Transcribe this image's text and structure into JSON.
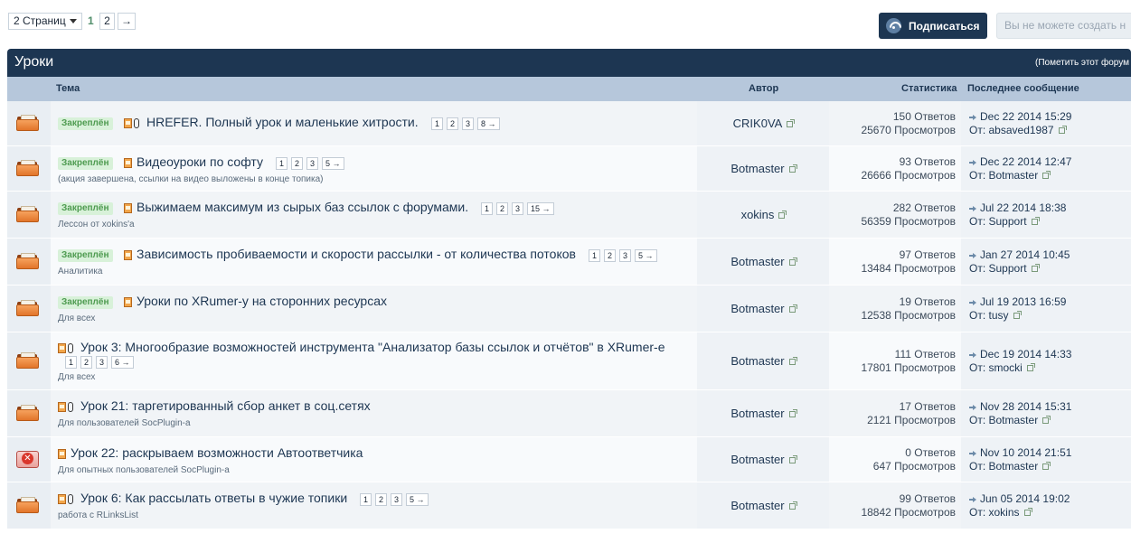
{
  "pagination": {
    "pages_label": "2 Страниц",
    "current": "1",
    "page2": "2",
    "next": "→"
  },
  "actions": {
    "subscribe": "Подписаться",
    "cannot_create": "Вы не можете создать н"
  },
  "forum": {
    "title": "Уроки",
    "mark_read": "(Пометить этот форум"
  },
  "columns": {
    "topic": "Тема",
    "author": "Автор",
    "stats": "Статистика",
    "last_post": "Последнее сообщение"
  },
  "pinned_label": "Закреплён",
  "colors": {
    "header_bg": "#1d3652",
    "column_header_bg": "#b6c7db",
    "pinned_bg": "#d8f1d9",
    "pinned_text": "#4e9b50"
  },
  "topics": [
    {
      "icon": "folder-icon",
      "pinned": true,
      "attachment": true,
      "title": "HREFER. Полный урок и маленькие хитрости.",
      "description": "",
      "pages": [
        "1",
        "2",
        "3",
        "8 →"
      ],
      "author": "CRIK0VA",
      "replies": "150 Ответов",
      "views": "25670 Просмотров",
      "last_date": "Dec 22 2014 15:29",
      "last_by": "От: absaved1987"
    },
    {
      "icon": "folder-icon",
      "pinned": true,
      "attachment": false,
      "title": "Видеоуроки по софту",
      "description": "(акция завершена, ссылки на видео выложены в конце топика)",
      "pages": [
        "1",
        "2",
        "3",
        "5 →"
      ],
      "author": "Botmaster",
      "replies": "93 Ответов",
      "views": "26666 Просмотров",
      "last_date": "Dec 22 2014 12:47",
      "last_by": "От: Botmaster"
    },
    {
      "icon": "folder-icon",
      "pinned": true,
      "attachment": false,
      "title": "Выжимаем максимум из сырых баз ссылок с форумами.",
      "description": "Лессон от xokins'а",
      "pages": [
        "1",
        "2",
        "3",
        "15 →"
      ],
      "author": "xokins",
      "replies": "282 Ответов",
      "views": "56359 Просмотров",
      "last_date": "Jul 22 2014 18:38",
      "last_by": "От: Support"
    },
    {
      "icon": "folder-icon",
      "pinned": true,
      "attachment": false,
      "title": "Зависимость пробиваемости и скорости рассылки - от количества потоков",
      "description": "Аналитика",
      "pages": [
        "1",
        "2",
        "3",
        "5 →"
      ],
      "author": "Botmaster",
      "replies": "97 Ответов",
      "views": "13484 Просмотров",
      "last_date": "Jan 27 2014 10:45",
      "last_by": "От: Support"
    },
    {
      "icon": "folder-icon",
      "pinned": true,
      "attachment": false,
      "title": "Уроки по XRumer-у на сторонних ресурсах",
      "description": "Для всех",
      "pages": [],
      "author": "Botmaster",
      "replies": "19 Ответов",
      "views": "12538 Просмотров",
      "last_date": "Jul 19 2013 16:59",
      "last_by": "От: tusy"
    },
    {
      "icon": "folder-icon",
      "pinned": false,
      "attachment": true,
      "title": "Урок 3: Многообразие возможностей инструмента \"Анализатор базы ссылок и отчётов\" в XRumer-е",
      "description": "Для всех",
      "pages": [
        "1",
        "2",
        "3",
        "6 →"
      ],
      "author": "Botmaster",
      "replies": "111 Ответов",
      "views": "17801 Просмотров",
      "last_date": "Dec 19 2014 14:33",
      "last_by": "От: smocki"
    },
    {
      "icon": "folder-icon",
      "pinned": false,
      "attachment": true,
      "title": "Урок 21: таргетированный сбор анкет в соц.сетях",
      "description": "Для пользователей SocPlugin-а",
      "pages": [],
      "author": "Botmaster",
      "replies": "17 Ответов",
      "views": "2121 Просмотров",
      "last_date": "Nov 28 2014 15:31",
      "last_by": "От: Botmaster"
    },
    {
      "icon": "locked-topic-icon",
      "pinned": false,
      "attachment": false,
      "title": "Урок 22: раскрываем возможности Автоответчика",
      "description": "Для опытных пользователей SocPlugin-а",
      "pages": [],
      "author": "Botmaster",
      "replies": "0 Ответов",
      "views": "647 Просмотров",
      "last_date": "Nov 10 2014 21:51",
      "last_by": "От: Botmaster"
    },
    {
      "icon": "folder-icon",
      "pinned": false,
      "attachment": true,
      "title": "Урок 6: Как рассылать ответы в чужие топики",
      "description": "работа с RLinksList",
      "pages": [
        "1",
        "2",
        "3",
        "5 →"
      ],
      "author": "Botmaster",
      "replies": "99 Ответов",
      "views": "18842 Просмотров",
      "last_date": "Jun 05 2014 19:02",
      "last_by": "От: xokins"
    }
  ]
}
